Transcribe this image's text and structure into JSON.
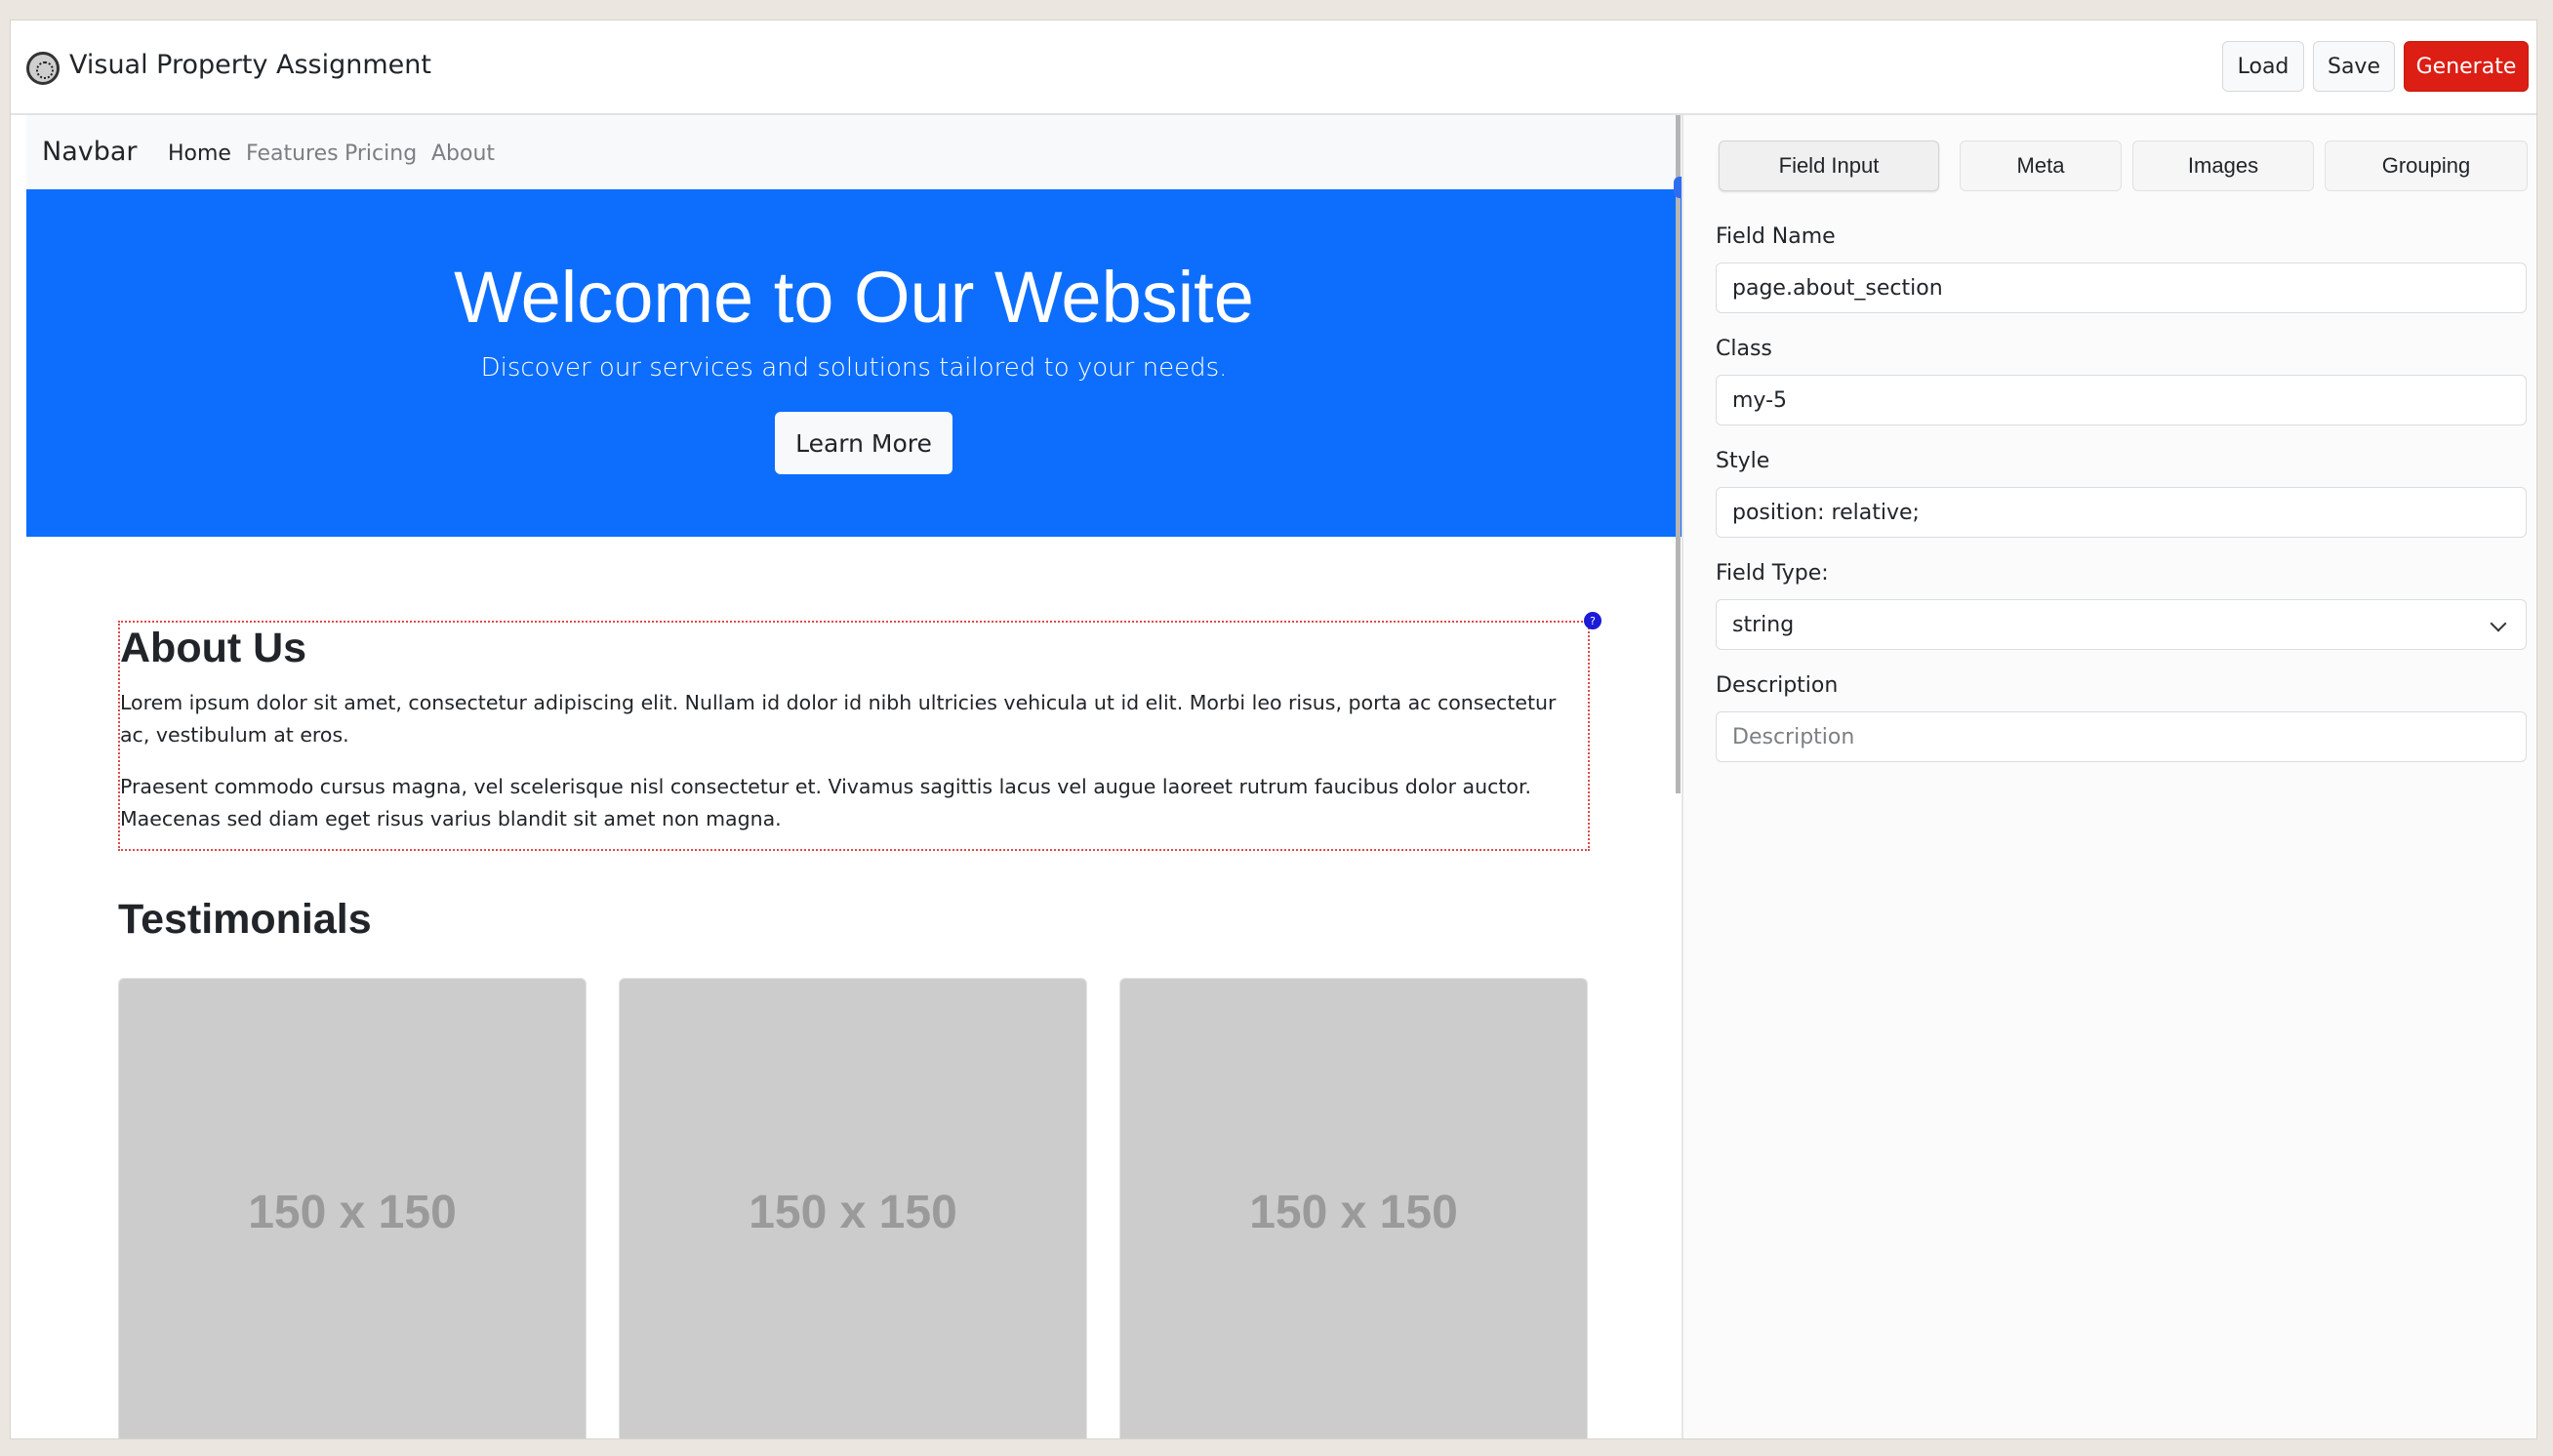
{
  "app": {
    "title": "Visual Property Assignment",
    "buttons": {
      "load": "Load",
      "save": "Save",
      "generate": "Generate"
    },
    "colors": {
      "generate": "#dc1e14",
      "hero": "#0d6efd",
      "selection": "#e04a4a"
    }
  },
  "preview": {
    "navbar": {
      "brand": "Navbar",
      "links": [
        "Home",
        "Features",
        "Pricing",
        "About"
      ]
    },
    "hero": {
      "title": "Welcome to Our Website",
      "subtitle": "Discover our services and solutions tailored to your needs.",
      "button": "Learn More"
    },
    "about": {
      "handle": "?",
      "title": "About Us",
      "p1": "Lorem ipsum dolor sit amet, consectetur adipiscing elit. Nullam id dolor id nibh ultricies vehicula ut id elit. Morbi leo risus, porta ac consectetur ac, vestibulum at eros.",
      "p2": "Praesent commodo cursus magna, vel scelerisque nisl consectetur et. Vivamus sagittis lacus vel augue laoreet rutrum faucibus dolor auctor. Maecenas sed diam eget risus varius blandit sit amet non magna."
    },
    "testimonials": {
      "title": "Testimonials",
      "placeholders": [
        "150 x 150",
        "150 x 150",
        "150 x 150"
      ]
    }
  },
  "panel": {
    "tabs": [
      "Field Input",
      "Meta",
      "Images",
      "Grouping"
    ],
    "active_tab": "Field Input",
    "fields": {
      "name": {
        "label": "Field Name",
        "value": "page.about_section"
      },
      "class": {
        "label": "Class",
        "value": "my-5"
      },
      "style": {
        "label": "Style",
        "value": "position: relative;"
      },
      "type": {
        "label": "Field Type:",
        "value": "string"
      },
      "description": {
        "label": "Description",
        "placeholder": "Description"
      }
    }
  }
}
